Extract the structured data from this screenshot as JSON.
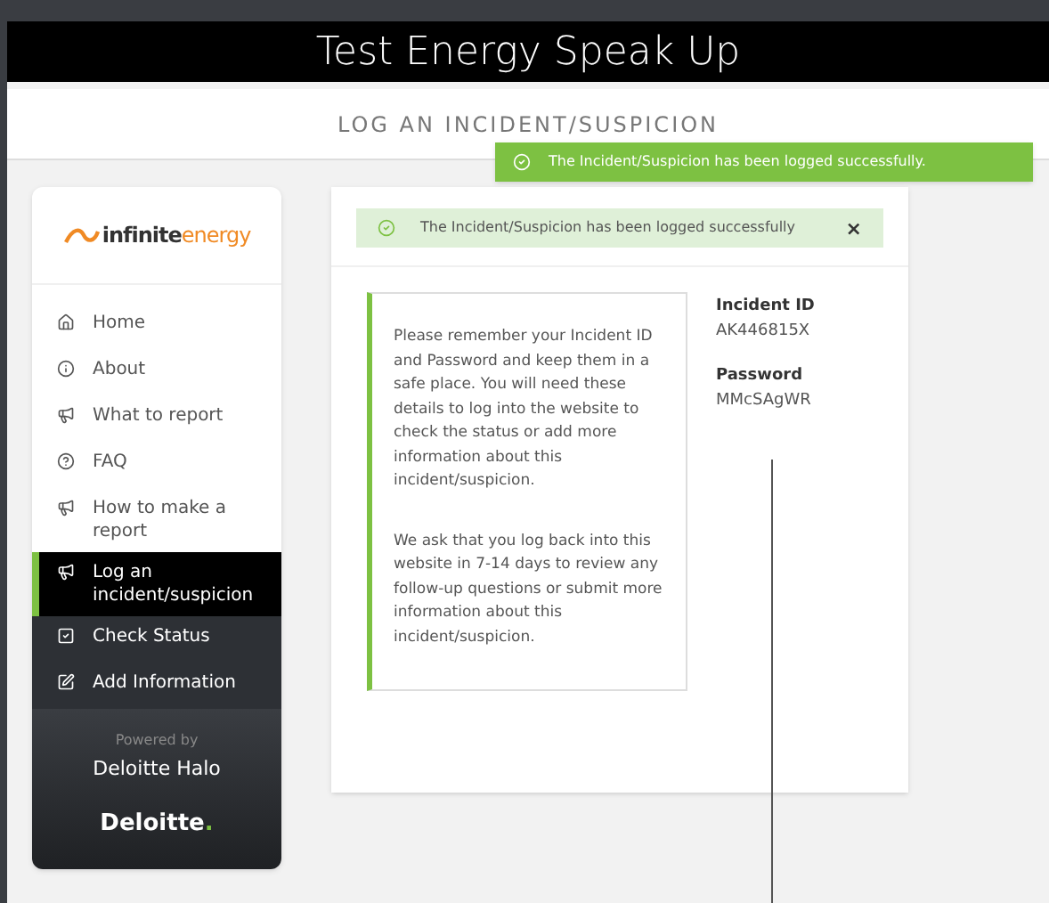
{
  "header": {
    "title": "Test Energy Speak Up"
  },
  "subheader": {
    "title": "LOG AN INCIDENT/SUSPICION"
  },
  "toast": {
    "message": "The Incident/Suspicion has been logged successfully."
  },
  "sidebar": {
    "logo": {
      "prefix": "infinite",
      "suffix": "energy"
    },
    "items": [
      {
        "label": "Home",
        "selected": false
      },
      {
        "label": "About",
        "selected": false
      },
      {
        "label": "What to report",
        "selected": false
      },
      {
        "label": "FAQ",
        "selected": false
      },
      {
        "label": "How to make a report",
        "selected": false
      },
      {
        "label": "Log an incident/suspicion",
        "selected": true
      },
      {
        "label": "Check Status",
        "selected": false
      },
      {
        "label": "Add Information",
        "selected": false
      }
    ],
    "footer": {
      "powered_by": "Powered by",
      "product": "Deloitte Halo",
      "brand": "Deloitte",
      "brand_dot": "."
    }
  },
  "alert": {
    "message": "The Incident/Suspicion has been logged successfully",
    "close": "×"
  },
  "notice": {
    "paragraphs": [
      "Please remember your Incident ID and Password and keep them in a safe place. You will need these details to log into the website to check the status or add more information about this incident/suspicion.",
      "We ask that you log back into this website in 7-14 days to review any follow-up questions or submit more information about this incident/suspicion."
    ]
  },
  "credentials": [
    {
      "label": "Incident ID",
      "value": "AK446815X"
    },
    {
      "label": "Password",
      "value": "MMcSAgWR"
    }
  ]
}
